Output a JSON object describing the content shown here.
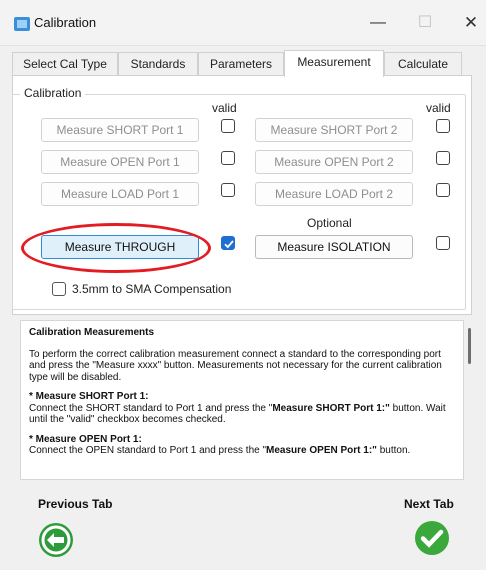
{
  "window": {
    "title": "Calibration",
    "minimize_glyph": "—",
    "maximize_glyph": "☐",
    "close_glyph": "✕",
    "icon": "calibration-app-icon"
  },
  "tabs": [
    {
      "label": "Select Cal Type"
    },
    {
      "label": "Standards"
    },
    {
      "label": "Parameters"
    },
    {
      "label": "Measurement",
      "active": true
    },
    {
      "label": "Calculate"
    }
  ],
  "calibration": {
    "group_label": "Calibration",
    "valid_label": "valid",
    "optional_label": "Optional",
    "port1": {
      "short_label": "Measure SHORT Port 1",
      "open_label": "Measure OPEN Port 1",
      "load_label": "Measure LOAD Port 1"
    },
    "port2": {
      "short_label": "Measure SHORT Port 2",
      "open_label": "Measure OPEN Port 2",
      "load_label": "Measure LOAD Port 2"
    },
    "through_label": "Measure THROUGH",
    "through_valid": true,
    "isolation_label": "Measure ISOLATION",
    "compensation_label": "3.5mm to SMA Compensation"
  },
  "help": {
    "heading": "Calibration Measurements",
    "intro": "To perform the correct calibration measurement connect a standard to the corresponding port and press the \"Measure xxxx\" button. Measurements not necessary for the current calibration type will be disabled.",
    "s1_title": "* Measure SHORT Port 1:",
    "s1_a": "Connect the SHORT standard to Port 1 and press the \"",
    "s1_b": "Measure SHORT Port 1:\"",
    "s1_c": " button. Wait until the \"valid\" checkbox becomes checked.",
    "s2_title": "* Measure OPEN Port 1:",
    "s2_a": "Connect the OPEN standard to Port 1 and press the \"",
    "s2_b": "Measure OPEN Port 1:\"",
    "s2_c": " button."
  },
  "nav": {
    "previous_label": "Previous Tab",
    "next_label": "Next Tab"
  },
  "colors": {
    "accent": "#1f6fd0",
    "highlight_ring": "#e31b23",
    "next_green": "#3aa83a",
    "prev_green": "#2e9b3a"
  }
}
